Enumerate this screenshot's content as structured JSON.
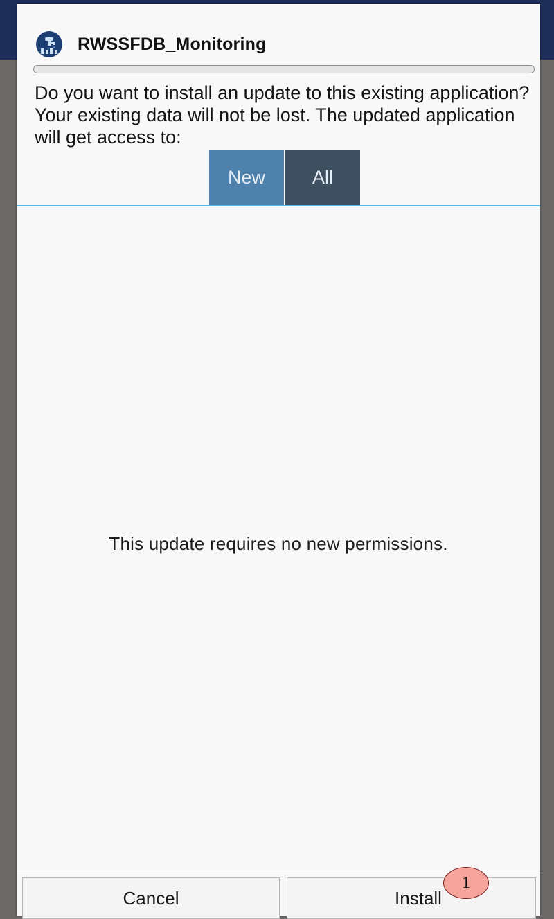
{
  "dialog": {
    "app_title": "RWSSFDB_Monitoring",
    "message": "Do you want to install an update to this existing application? Your existing data will not be lost. The updated application will get access to:",
    "tabs": [
      {
        "label": "New",
        "selected": true
      },
      {
        "label": "All",
        "selected": false
      }
    ],
    "no_permissions_text": "This update requires no new permissions.",
    "buttons": {
      "cancel_label": "Cancel",
      "install_label": "Install"
    },
    "annotation_marker": "1"
  },
  "colors": {
    "tab_new": "#4f81ad",
    "tab_all": "#3d4e5e",
    "tab_underline": "#5bb3dd",
    "statusbar": "#1c2e58",
    "marker_fill": "#f5a59b"
  },
  "icons": {
    "app_icon": "water-tap-app-icon"
  }
}
